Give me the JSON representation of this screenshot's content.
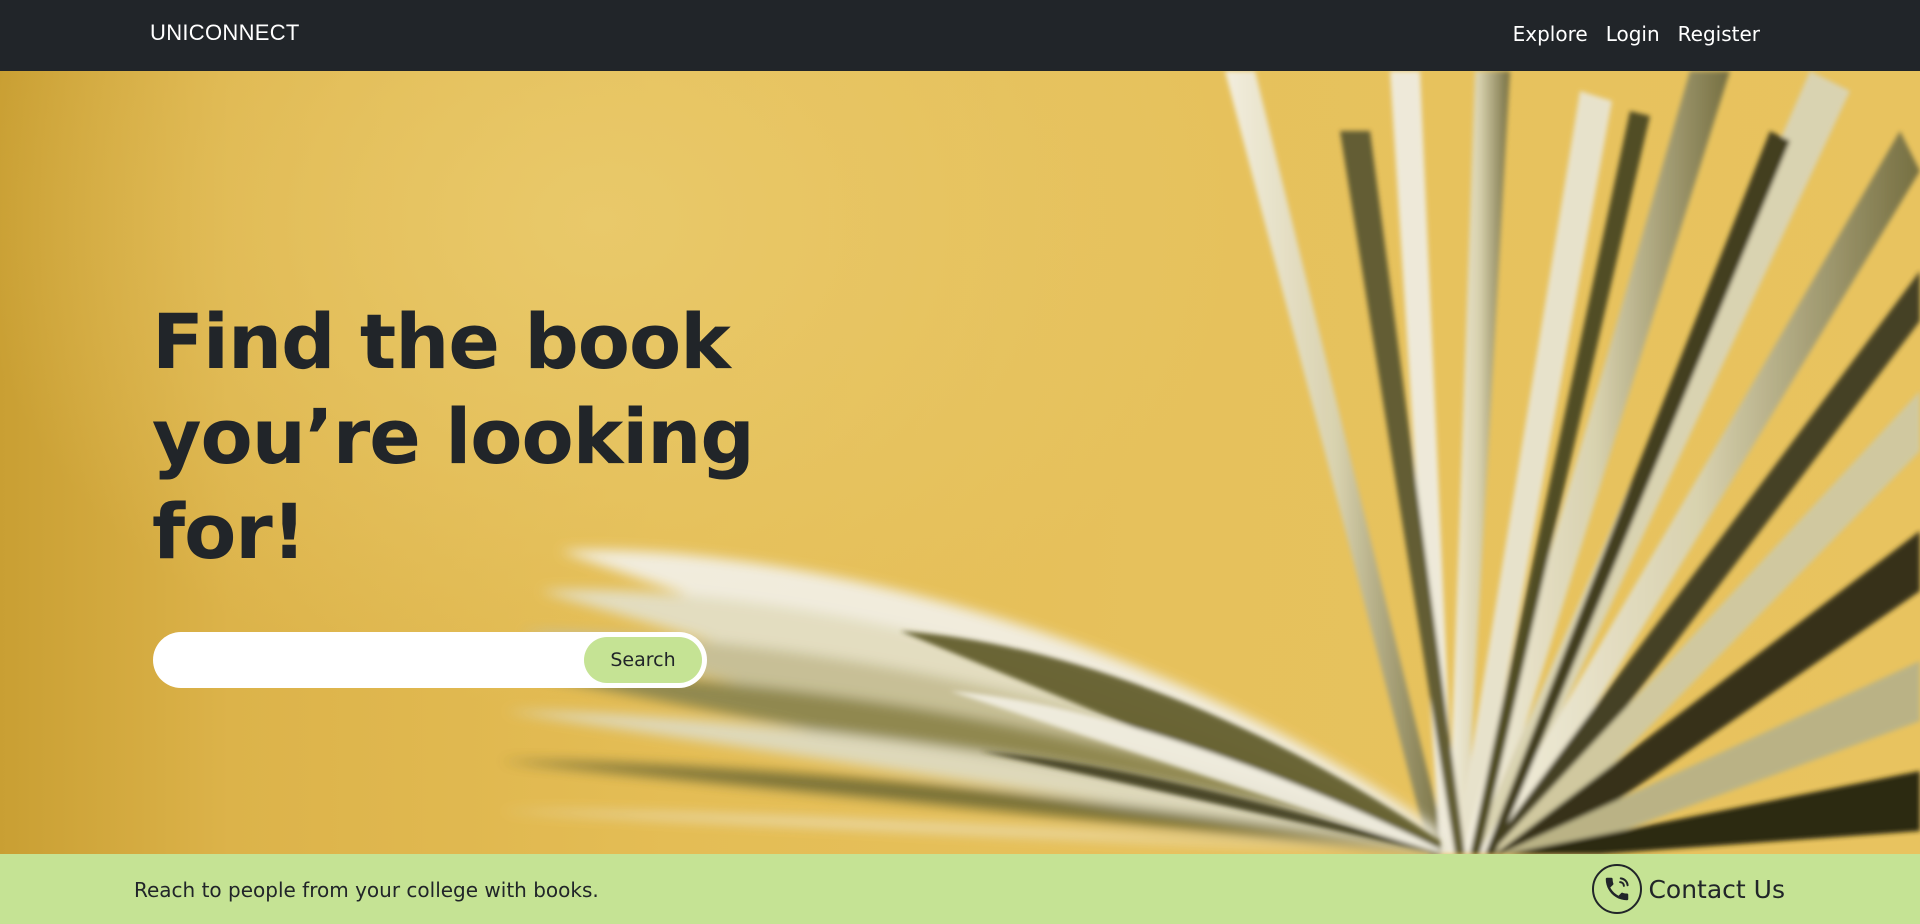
{
  "navbar": {
    "brand": "UNICONNECT",
    "links": [
      "Explore",
      "Login",
      "Register"
    ]
  },
  "hero": {
    "headline_lines": [
      "Find the book",
      "you’re looking",
      "for!"
    ],
    "search": {
      "value": "",
      "placeholder": "",
      "button_label": "Search"
    }
  },
  "footer": {
    "tagline": "Reach to people from your college with books.",
    "contact_label": "Contact Us",
    "contact_icon": "phone-icon"
  },
  "colors": {
    "navbar_bg": "#212529",
    "accent_green": "#c5e394",
    "hero_yellow": "#e2b94f",
    "text_dark": "#212529"
  }
}
